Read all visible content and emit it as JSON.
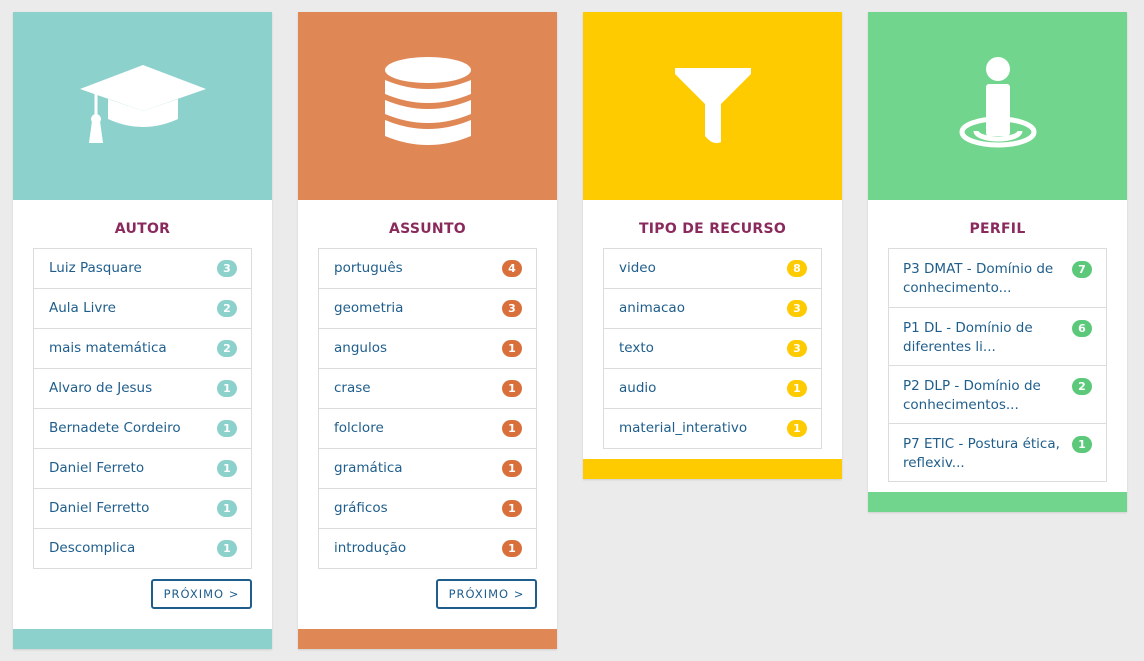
{
  "cards": [
    {
      "title": "AUTOR",
      "color": "#8dd1cd",
      "icon": "graduation-cap-icon",
      "items": [
        {
          "label": "Luiz Pasquare",
          "count": "3"
        },
        {
          "label": "Aula Livre",
          "count": "2"
        },
        {
          "label": "mais matemática",
          "count": "2"
        },
        {
          "label": "Alvaro de Jesus",
          "count": "1"
        },
        {
          "label": "Bernadete Cordeiro",
          "count": "1"
        },
        {
          "label": "Daniel Ferreto",
          "count": "1"
        },
        {
          "label": "Daniel Ferretto",
          "count": "1"
        },
        {
          "label": "Descomplica",
          "count": "1"
        }
      ],
      "next_label": "PRÓXIMO >"
    },
    {
      "title": "ASSUNTO",
      "color": "#e08756",
      "badge_color": "#d9703c",
      "icon": "database-icon",
      "items": [
        {
          "label": "português",
          "count": "4"
        },
        {
          "label": "geometria",
          "count": "3"
        },
        {
          "label": "angulos",
          "count": "1"
        },
        {
          "label": "crase",
          "count": "1"
        },
        {
          "label": "folclore",
          "count": "1"
        },
        {
          "label": "gramática",
          "count": "1"
        },
        {
          "label": "gráficos",
          "count": "1"
        },
        {
          "label": "introdução",
          "count": "1"
        }
      ],
      "next_label": "PRÓXIMO >"
    },
    {
      "title": "TIPO DE RECURSO",
      "color": "#fecb00",
      "icon": "filter-icon",
      "items": [
        {
          "label": "video",
          "count": "8"
        },
        {
          "label": "animacao",
          "count": "3"
        },
        {
          "label": "texto",
          "count": "3"
        },
        {
          "label": "audio",
          "count": "1"
        },
        {
          "label": "material_interativo",
          "count": "1"
        }
      ]
    },
    {
      "title": "PERFIL",
      "color": "#72d58e",
      "badge_color": "#5cc97a",
      "icon": "person-location-icon",
      "items": [
        {
          "line1": "P3 DMAT - Domínio de",
          "line2": "conhecimento...",
          "count": "7"
        },
        {
          "line1": "P1 DL - Domínio de",
          "line2": "diferentes li...",
          "count": "6"
        },
        {
          "line1": "P2 DLP - Domínio de",
          "line2": "conhecimentos...",
          "count": "2"
        },
        {
          "line1": "P7 ETIC - Postura ética,",
          "line2": "reflexiv...",
          "count": "1"
        }
      ]
    }
  ]
}
